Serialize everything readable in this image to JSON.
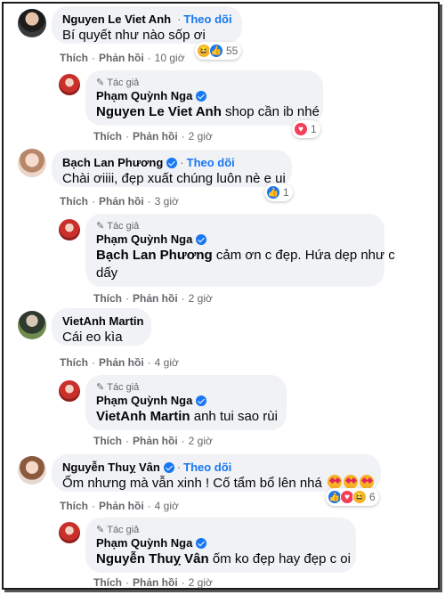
{
  "labels": {
    "like": "Thích",
    "reply": "Phản hồi",
    "follow": "Theo dõi",
    "author": "Tác giả"
  },
  "colors": {
    "accent": "#1877f2",
    "bubble": "#f0f2f5",
    "muted": "#65676b"
  },
  "comments": [
    {
      "name": "Nguyen Le Viet Anh",
      "text": "Bí quyết như nào sốp ơi",
      "time": "10 giờ",
      "reactions": {
        "icons": [
          "haha-icon",
          "like-icon"
        ],
        "count": "55"
      },
      "reply": {
        "name": "Phạm Quỳnh Nga",
        "tag": "Nguyen Le Viet Anh",
        "text": "shop cần ib nhé",
        "time": "2 giờ",
        "reactions": {
          "icons": [
            "love-icon"
          ],
          "count": "1"
        }
      }
    },
    {
      "name": "Bạch Lan Phương",
      "text": "Chài ơiiii, đẹp xuất chúng luôn nè e ui",
      "time": "3 giờ",
      "reactions": {
        "icons": [
          "like-icon"
        ],
        "count": "1"
      },
      "reply": {
        "name": "Phạm Quỳnh Nga",
        "tag": "Bạch Lan Phương",
        "text_line1": "cảm ơn c đẹp. Hứa dẹp như c",
        "text_line2": "dấy",
        "time": "2 giờ"
      }
    },
    {
      "name": "VietAnh Martin",
      "text": "Cái eo kìa",
      "time": "4 giờ",
      "reply": {
        "name": "Phạm Quỳnh Nga",
        "tag": "VietAnh Martin",
        "text": "anh tui sao rùi",
        "time": "2 giờ"
      }
    },
    {
      "name": "Nguyễn Thuỵ Vân",
      "text": "Ốm nhưng mà vẫn xinh ! Cố tẩm bổ lên nhá",
      "time": "4 giờ",
      "reactions": {
        "icons": [
          "like-icon",
          "love-icon",
          "haha-icon"
        ],
        "count": "6"
      },
      "reply": {
        "name": "Phạm Quỳnh Nga",
        "tag": "Nguyễn Thuỵ Vân",
        "text": "ốm ko đẹp hay đẹp c oi",
        "time": "2 giờ"
      }
    }
  ]
}
